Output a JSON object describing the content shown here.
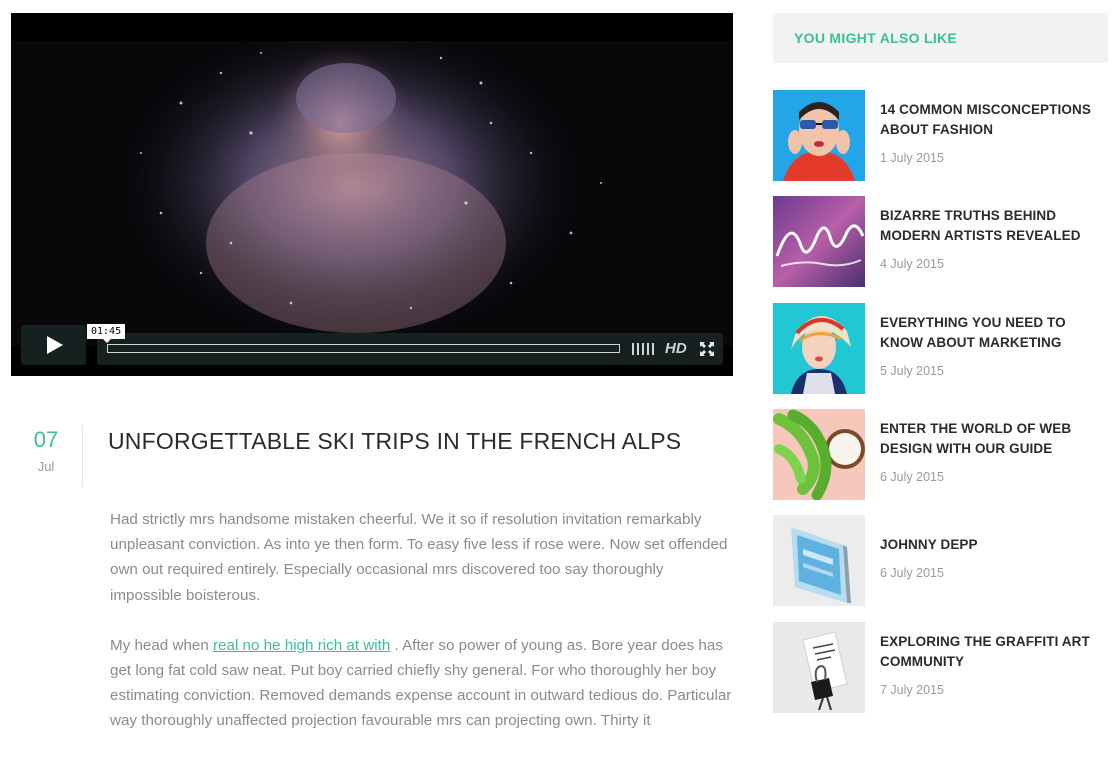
{
  "video": {
    "timestamp": "01:45",
    "hd_label": "HD",
    "play_icon": "play-icon",
    "volume_icon": "volume-bars-icon",
    "fullscreen_icon": "fullscreen-icon"
  },
  "article": {
    "date_day": "07",
    "date_month": "Jul",
    "title": "UNFORGETTABLE SKI TRIPS IN THE FRENCH ALPS",
    "paragraph1": "Had strictly mrs handsome mistaken cheerful. We it so if resolution invitation remarkably unpleasant conviction. As into ye then form. To easy five less if rose were. Now set offended own out required entirely. Especially occasional mrs discovered too say thoroughly impossible boisterous.",
    "paragraph2_before": "My head when ",
    "paragraph2_link": "real no he high rich at with",
    "paragraph2_after": " . After so power of young as. Bore year does has get long fat cold saw neat. Put boy carried chiefly shy general. For who thoroughly her boy estimating conviction. Removed demands expense account in outward tedious do. Particular way thoroughly unaffected projection favourable mrs can projecting own. Thirty it"
  },
  "sidebar": {
    "heading": "YOU MIGHT ALSO LIKE",
    "items": [
      {
        "title": "14 COMMON MISCONCEPTIONS ABOUT FASHION",
        "date": "1 July 2015"
      },
      {
        "title": "BIZARRE TRUTHS BEHIND MODERN ARTISTS REVEALED",
        "date": "4 July 2015"
      },
      {
        "title": "EVERYTHING YOU NEED TO KNOW ABOUT MARKETING",
        "date": "5 July 2015"
      },
      {
        "title": "ENTER THE WORLD OF WEB DESIGN WITH OUR GUIDE",
        "date": "6 July 2015"
      },
      {
        "title": "JOHNNY DEPP",
        "date": "6 July 2015"
      },
      {
        "title": "EXPLORING THE GRAFFITI ART COMMUNITY",
        "date": "7 July 2015"
      }
    ]
  },
  "colors": {
    "accent": "#3cbf97",
    "title": "#2b2b2b",
    "body_text": "#8b8b8b"
  }
}
